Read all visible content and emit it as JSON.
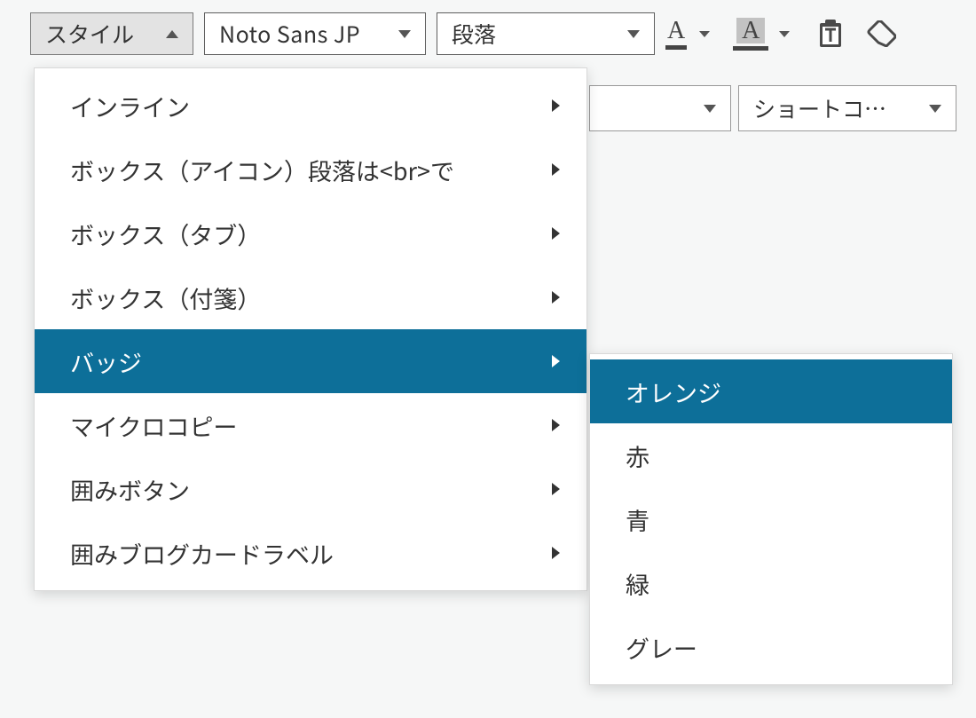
{
  "toolbar": {
    "style_label": "スタイル",
    "font_label": "Noto Sans JP",
    "format_label": "段落",
    "textcolor_glyph": "A",
    "bgcolor_glyph": "A",
    "shortcode_label": "ショートコ…"
  },
  "style_menu": {
    "items": [
      {
        "label": "インライン"
      },
      {
        "label": "ボックス（アイコン）段落は<br>で"
      },
      {
        "label": "ボックス（タブ）"
      },
      {
        "label": "ボックス（付箋）"
      },
      {
        "label": "バッジ"
      },
      {
        "label": "マイクロコピー"
      },
      {
        "label": "囲みボタン"
      },
      {
        "label": "囲みブログカードラベル"
      }
    ],
    "active_index": 4
  },
  "badge_submenu": {
    "items": [
      {
        "label": "オレンジ"
      },
      {
        "label": "赤"
      },
      {
        "label": "青"
      },
      {
        "label": "緑"
      },
      {
        "label": "グレー"
      }
    ],
    "active_index": 0
  }
}
